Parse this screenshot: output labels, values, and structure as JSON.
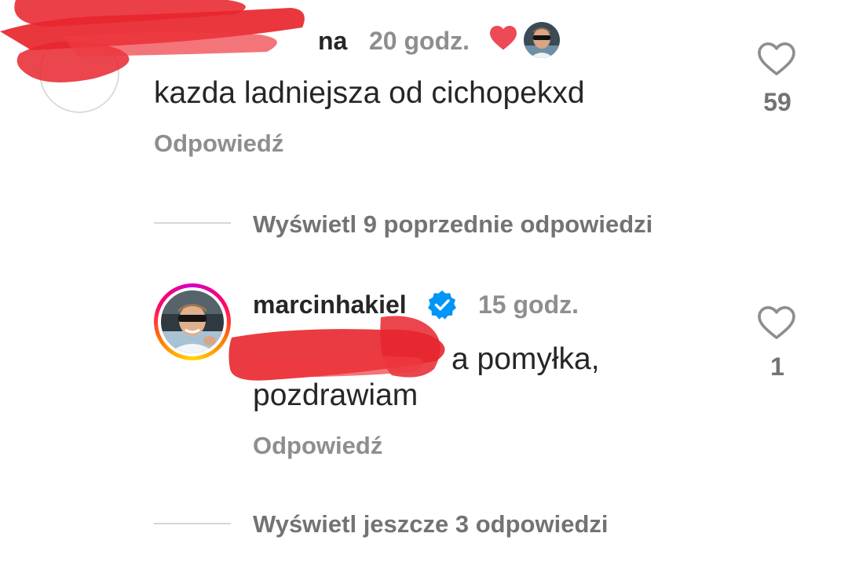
{
  "comments": [
    {
      "username": "na",
      "time": "20 godz.",
      "text": "kazda ladniejsza od cichopekxd",
      "reply_label": "Odpowiedź",
      "like_count": "59",
      "liked_by_author": true,
      "like_icon": "heart-outline-icon",
      "author_like_icon": "heart-filled-icon"
    }
  ],
  "thread": {
    "view_previous": "Wyświetl 9 poprzednie odpowiedzi",
    "view_more": "Wyświetl jeszcze 3 odpowiedzi"
  },
  "reply": {
    "username": "marcinhakiel",
    "verified": true,
    "time": "15 godz.",
    "text_line1": "a pomyłka,",
    "text_line2": "pozdrawiam",
    "reply_label": "Odpowiedź",
    "like_count": "1",
    "like_icon": "heart-outline-icon",
    "has_story_ring": true
  },
  "colors": {
    "text": "#262626",
    "secondary": "#8e8e8e",
    "like_red": "#ed4956",
    "verified_blue": "#0095f6",
    "redaction": "#e8262e"
  }
}
